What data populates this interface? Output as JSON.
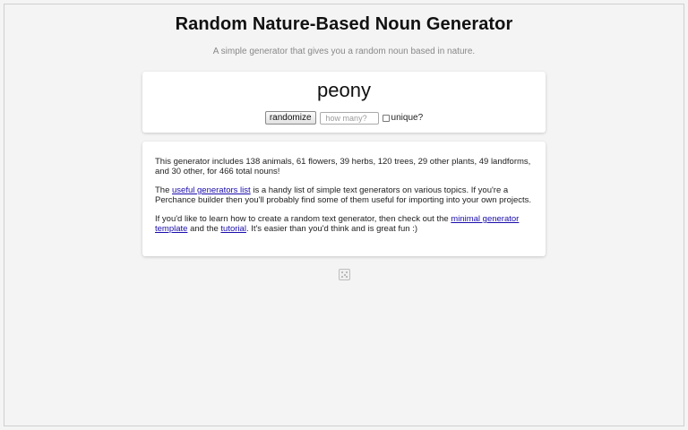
{
  "header": {
    "title": "Random Nature-Based Noun Generator",
    "subtitle": "A simple generator that gives you a random noun based in nature."
  },
  "generator": {
    "result": "peony",
    "randomize_label": "randomize",
    "count_placeholder": "how many?",
    "count_value": "",
    "unique_label": "unique?",
    "unique_checked": false
  },
  "info": {
    "p1": "This generator includes 138 animals, 61 flowers, 39 herbs, 120 trees, 29 other plants, 49 landforms, and 30 other, for 466 total nouns!",
    "p2_before": "The ",
    "p2_link": "useful generators list",
    "p2_after": " is a handy list of simple text generators on various topics. If you're a Perchance builder then you'll probably find some of them useful for importing into your own projects.",
    "p3_before": "If you'd like to learn how to create a random text generator, then check out the ",
    "p3_link1": "minimal generator template",
    "p3_mid": " and the ",
    "p3_link2": "tutorial",
    "p3_after": ". It's easier than you'd think and is great fun :)"
  },
  "footer": {
    "icon": "dice-icon"
  },
  "colors": {
    "page_bg": "#f4f4f4",
    "card_bg": "#ffffff",
    "link": "#1a0dab",
    "subtitle": "#888888"
  }
}
